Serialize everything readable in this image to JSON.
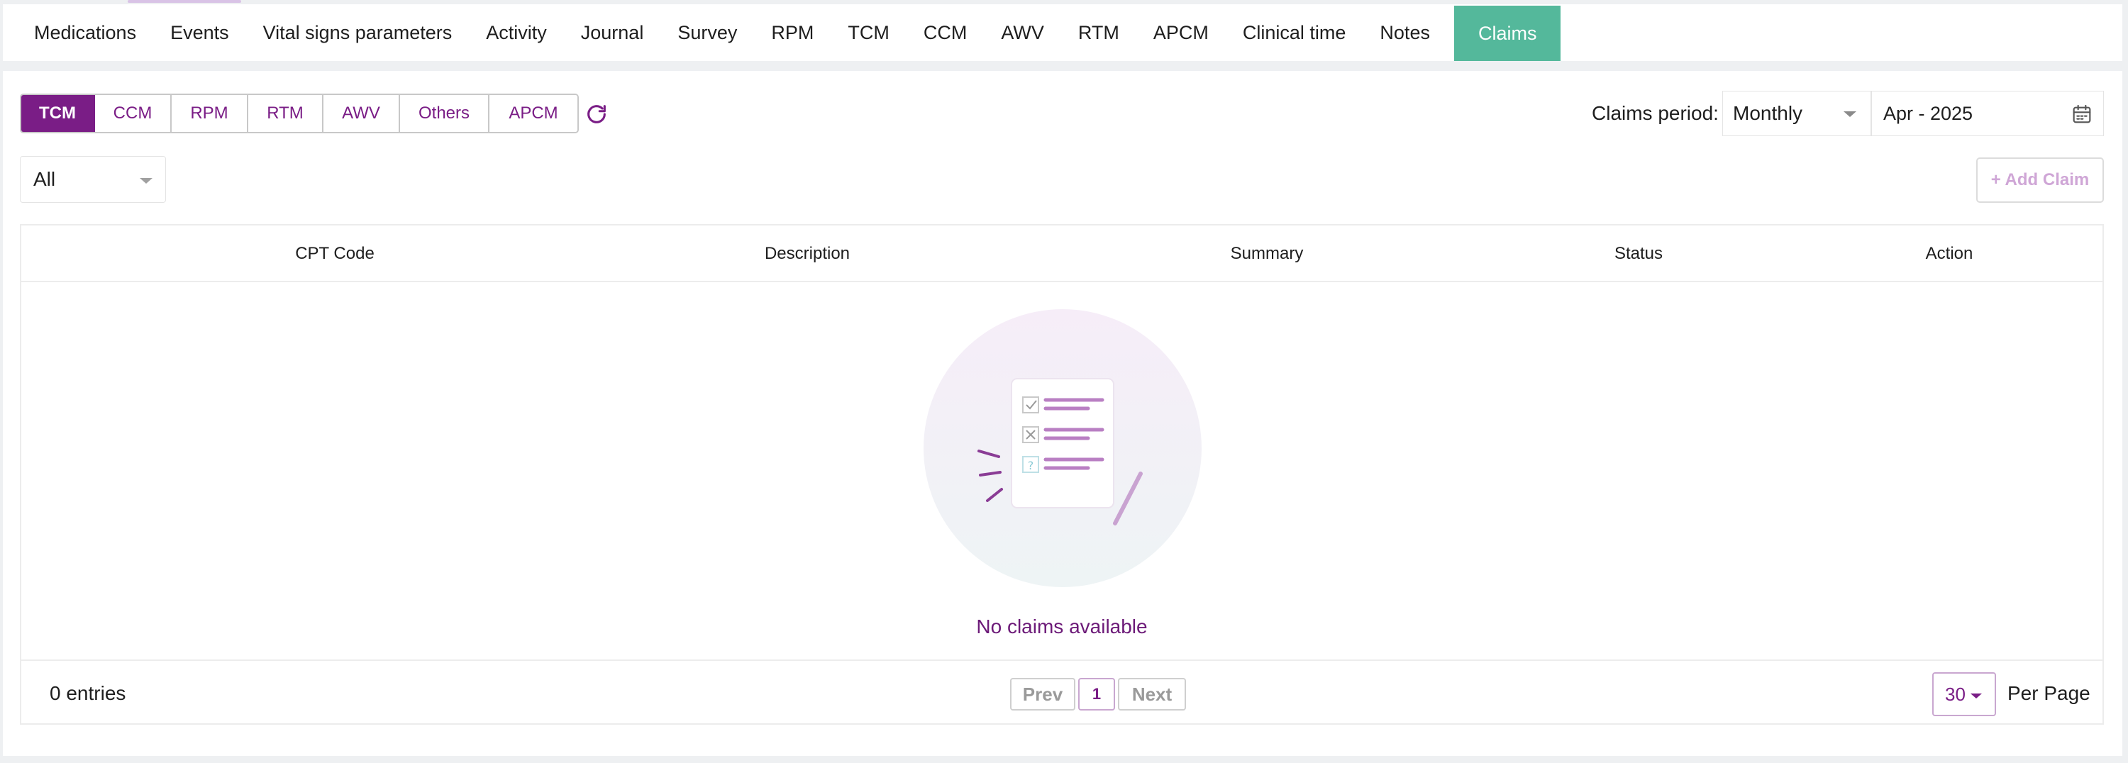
{
  "top_nav": {
    "tabs": [
      {
        "label": "Medications"
      },
      {
        "label": "Events"
      },
      {
        "label": "Vital signs parameters"
      },
      {
        "label": "Activity"
      },
      {
        "label": "Journal"
      },
      {
        "label": "Survey"
      },
      {
        "label": "RPM"
      },
      {
        "label": "TCM"
      },
      {
        "label": "CCM"
      },
      {
        "label": "AWV"
      },
      {
        "label": "RTM"
      },
      {
        "label": "APCM"
      },
      {
        "label": "Clinical time"
      },
      {
        "label": "Notes"
      },
      {
        "label": "Claims",
        "active": true
      }
    ]
  },
  "sub_tabs": [
    {
      "label": "TCM",
      "active": true
    },
    {
      "label": "CCM"
    },
    {
      "label": "RPM"
    },
    {
      "label": "RTM"
    },
    {
      "label": "AWV"
    },
    {
      "label": "Others"
    },
    {
      "label": "APCM"
    }
  ],
  "claims_period": {
    "label": "Claims period:",
    "selected": "Monthly",
    "month_value": "Apr - 2025"
  },
  "filter": {
    "selected": "All"
  },
  "add_claim_label": "+ Add Claim",
  "table": {
    "columns": [
      "CPT Code",
      "Description",
      "Summary",
      "Status",
      "Action"
    ],
    "rows": [],
    "empty_message": "No claims available"
  },
  "footer": {
    "entries_text": "0 entries",
    "prev_label": "Prev",
    "current_page": "1",
    "next_label": "Next",
    "per_page_value": "30",
    "per_page_label": "Per Page"
  },
  "colors": {
    "brand_purple": "#7a1d86",
    "active_tab_green": "#54b89b"
  },
  "icons": {
    "refresh": "refresh-icon",
    "calendar": "calendar-icon",
    "dropdown": "chevron-down-icon"
  }
}
